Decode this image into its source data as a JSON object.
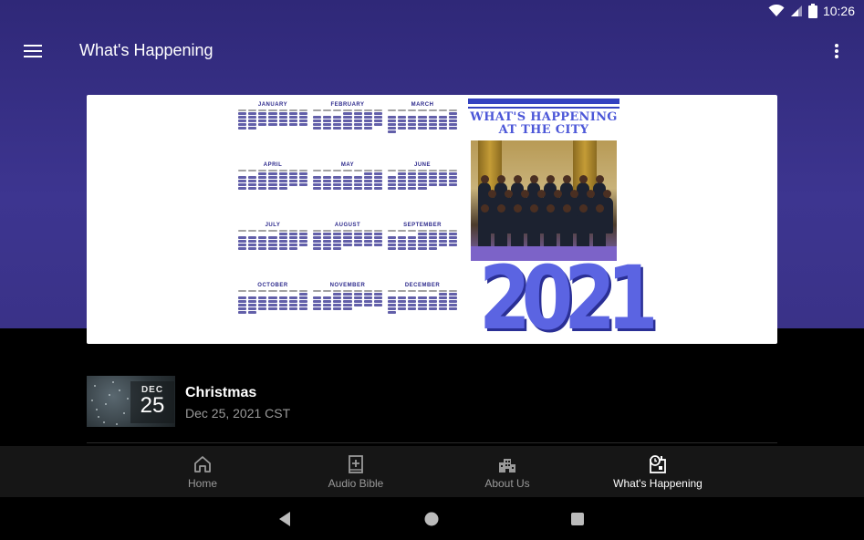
{
  "status_bar": {
    "time": "10:26"
  },
  "app_bar": {
    "title": "What's Happening"
  },
  "banner": {
    "months": [
      "JANUARY",
      "FEBRUARY",
      "MARCH",
      "APRIL",
      "MAY",
      "JUNE",
      "JULY",
      "AUGUST",
      "SEPTEMBER",
      "OCTOBER",
      "NOVEMBER",
      "DECEMBER"
    ],
    "poster_title_line1": "WHAT'S HAPPENING",
    "poster_title_line2": "AT THE CITY",
    "year": "2021"
  },
  "event": {
    "date_month": "DEC",
    "date_day": "25",
    "title": "Christmas",
    "date_text": "Dec 25, 2021 CST"
  },
  "bottom_nav": {
    "items": [
      {
        "label": "Home",
        "icon": "home-icon"
      },
      {
        "label": "Audio Bible",
        "icon": "book-plus-icon"
      },
      {
        "label": "About Us",
        "icon": "building-icon"
      },
      {
        "label": "What's Happening",
        "icon": "calendar-clock-icon"
      }
    ],
    "active_index": 3
  },
  "colors": {
    "header_bg": "#3a3288",
    "accent_blue": "#5b64e2",
    "nav_bg": "#161616"
  }
}
